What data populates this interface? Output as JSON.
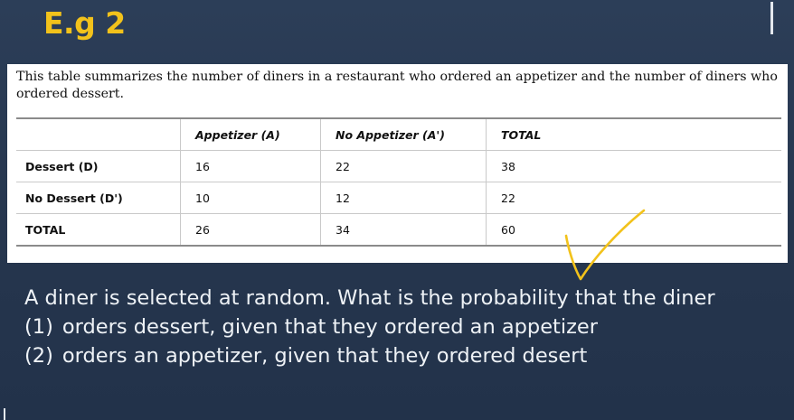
{
  "slide": {
    "title": "E.g 2"
  },
  "problem": {
    "intro": "This table summarizes the number of diners in a restaurant who ordered an appetizer and the number of diners who ordered dessert.",
    "table": {
      "headers": [
        "",
        "Appetizer (A)",
        "No Appetizer (A')",
        "TOTAL"
      ],
      "rows": [
        {
          "label": "Dessert (D)",
          "values": [
            "16",
            "22",
            "38"
          ]
        },
        {
          "label": "No Dessert (D')",
          "values": [
            "10",
            "12",
            "22"
          ]
        },
        {
          "label": "TOTAL",
          "values": [
            "26",
            "34",
            "60"
          ]
        }
      ]
    }
  },
  "question": {
    "prompt": "A diner is selected at random. What is the probability that the diner",
    "parts": [
      {
        "number": "(1)",
        "text": "orders dessert, given that they ordered an appetizer"
      },
      {
        "number": "(2)",
        "text": "orders an appetizer, given that they ordered desert"
      }
    ]
  },
  "annotation": {
    "icon": "handwritten-checkmark-icon",
    "color": "#f2c21b"
  }
}
